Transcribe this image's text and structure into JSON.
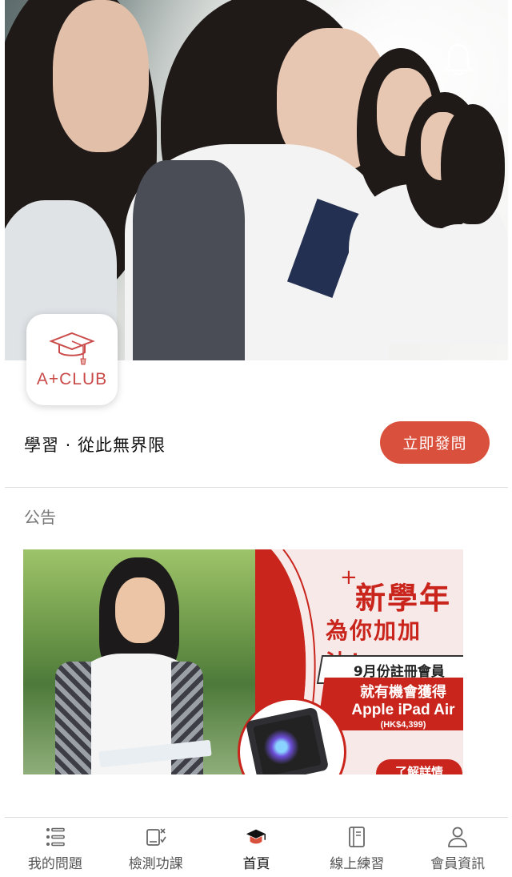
{
  "hero": {
    "notification_icon": "bell-icon"
  },
  "brand": {
    "logo_text": "A+CLUB",
    "logo_icon": "graduation-cap-icon",
    "slogan": "學習 · 從此無界限",
    "ask_button": "立即發問"
  },
  "announcements": {
    "title": "公告",
    "banner": {
      "headline": "新學年",
      "subheadline": "為你加加油！",
      "box_text": "9月份註冊會員",
      "offer_line1": "就有機會獲得",
      "offer_line2": "Apple iPad Air",
      "price": "(HK$4,399)",
      "more_button": "了解詳情"
    }
  },
  "tabbar": {
    "items": [
      {
        "label": "我的問題",
        "icon": "list-icon"
      },
      {
        "label": "檢測功課",
        "icon": "homework-check-icon"
      },
      {
        "label": "首頁",
        "icon": "home-cap-icon"
      },
      {
        "label": "線上練習",
        "icon": "notebook-icon"
      },
      {
        "label": "會員資訊",
        "icon": "user-icon"
      }
    ],
    "active_index": 2
  },
  "colors": {
    "accent": "#d9503c",
    "banner_red": "#c9251c"
  }
}
